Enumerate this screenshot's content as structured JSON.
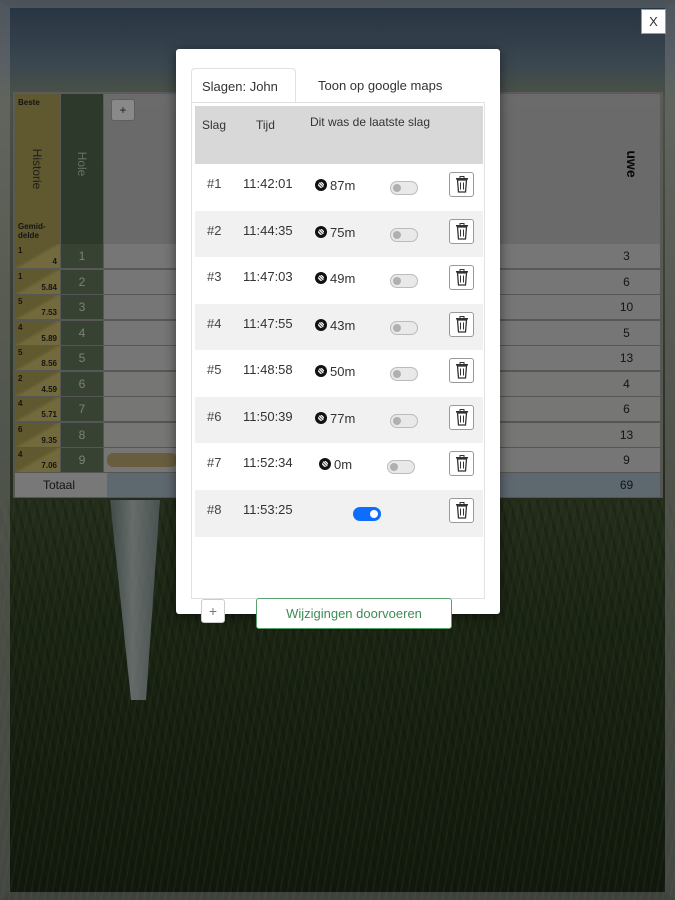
{
  "close_label": "X",
  "background": {
    "plus_label": "+",
    "history_top": "Beste",
    "history_mid": "Historie",
    "history_bottom": "Gemid-\ndelde",
    "hole_label": "Hole",
    "player_label": "uwe",
    "total_label": "Totaal",
    "total_value": "69",
    "rows": [
      {
        "par": "1",
        "avg": "4",
        "hole": "1",
        "value": "3"
      },
      {
        "par": "1",
        "avg": "5.84",
        "hole": "2",
        "value": "6"
      },
      {
        "par": "5",
        "avg": "7.53",
        "hole": "3",
        "value": "10"
      },
      {
        "par": "4",
        "avg": "5.89",
        "hole": "4",
        "value": "5"
      },
      {
        "par": "5",
        "avg": "8.56",
        "hole": "5",
        "value": "13"
      },
      {
        "par": "2",
        "avg": "4.59",
        "hole": "6",
        "value": "4"
      },
      {
        "par": "4",
        "avg": "5.71",
        "hole": "7",
        "value": "6"
      },
      {
        "par": "6",
        "avg": "9.35",
        "hole": "8",
        "value": "13"
      },
      {
        "par": "4",
        "avg": "7.06",
        "hole": "9",
        "value": "9"
      }
    ]
  },
  "modal": {
    "tabs": [
      {
        "label": "Slagen: John",
        "active": true
      },
      {
        "label": "Toon op google maps",
        "active": false
      }
    ],
    "headers": {
      "slag": "Slag",
      "tijd": "Tijd",
      "last": "Dit was de laatste slag"
    },
    "strokes": [
      {
        "nr": "#1",
        "time": "11:42:01",
        "distance": "87m",
        "last": false
      },
      {
        "nr": "#2",
        "time": "11:44:35",
        "distance": "75m",
        "last": false
      },
      {
        "nr": "#3",
        "time": "11:47:03",
        "distance": "49m",
        "last": false
      },
      {
        "nr": "#4",
        "time": "11:47:55",
        "distance": "43m",
        "last": false
      },
      {
        "nr": "#5",
        "time": "11:48:58",
        "distance": "50m",
        "last": false
      },
      {
        "nr": "#6",
        "time": "11:50:39",
        "distance": "77m",
        "last": false
      },
      {
        "nr": "#7",
        "time": "11:52:34",
        "distance": "0m",
        "last": false
      },
      {
        "nr": "#8",
        "time": "11:53:25",
        "distance": "",
        "last": true
      }
    ],
    "add_label": "+",
    "apply_label": "Wijzigingen doorvoeren"
  },
  "colors": {
    "toggle_on": "#0d6efd",
    "apply_border": "#5aa06d",
    "history_gold": "#9c8e4c",
    "hole_green": "#5a6b53"
  },
  "icons": [
    "golf-ball-icon",
    "trash-icon"
  ]
}
